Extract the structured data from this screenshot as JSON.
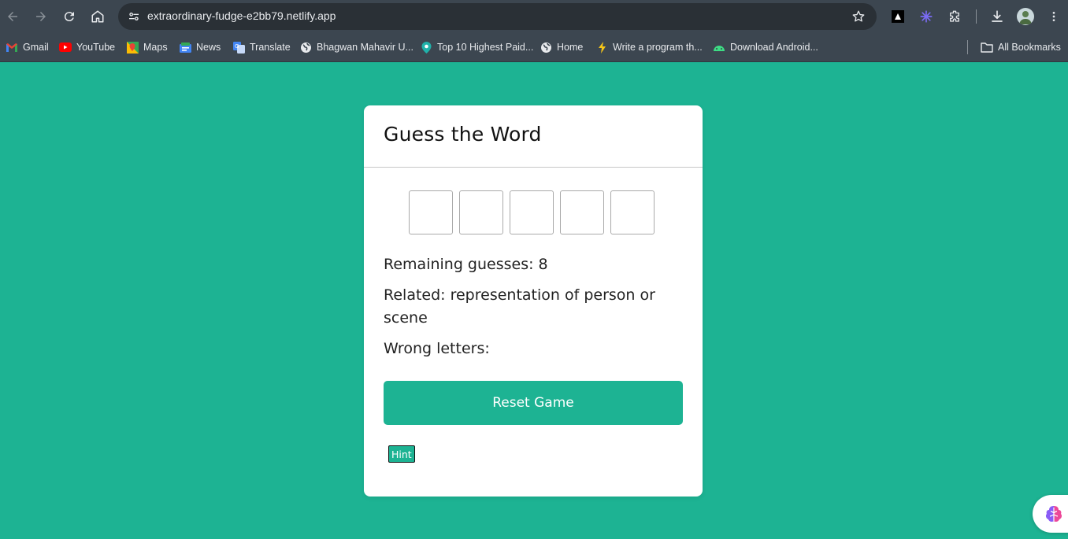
{
  "browser": {
    "url": "extraordinary-fudge-e2bb79.netlify.app",
    "icons": {
      "back": "arrow-left-icon",
      "forward": "arrow-right-icon",
      "reload": "reload-icon",
      "home": "home-icon",
      "site_info": "tune-icon",
      "bookmark_star": "star-icon",
      "downloads": "download-icon",
      "menu": "kebab-menu-icon"
    },
    "bookmarks": [
      {
        "label": "Gmail",
        "icon": "gmail-icon"
      },
      {
        "label": "YouTube",
        "icon": "youtube-icon"
      },
      {
        "label": "Maps",
        "icon": "maps-icon"
      },
      {
        "label": "News",
        "icon": "news-icon"
      },
      {
        "label": "Translate",
        "icon": "translate-icon"
      },
      {
        "label": "Bhagwan Mahavir U...",
        "icon": "globe-icon"
      },
      {
        "label": "Top 10 Highest Paid...",
        "icon": "pin-icon"
      },
      {
        "label": "Home",
        "icon": "globe-icon"
      },
      {
        "label": "Write a program th...",
        "icon": "bolt-icon"
      },
      {
        "label": "Download Android...",
        "icon": "android-icon"
      }
    ],
    "all_bookmarks_label": "All Bookmarks"
  },
  "game": {
    "title": "Guess the Word",
    "letters": [
      "",
      "",
      "",
      "",
      ""
    ],
    "remaining": "Remaining guesses: 8",
    "related": "Related: representation of person or scene",
    "wrong": "Wrong letters:",
    "reset_label": "Reset Game",
    "hint_label": "Hint"
  },
  "colors": {
    "page_background": "#1db393",
    "accent": "#1db393",
    "browser_chrome": "#3c4650"
  }
}
